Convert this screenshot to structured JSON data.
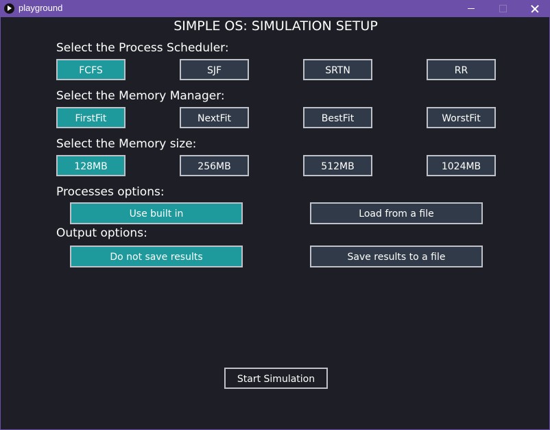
{
  "window": {
    "title": "playground"
  },
  "heading": "SIMPLE OS: SIMULATION SETUP",
  "scheduler": {
    "label": "Select the Process Scheduler:",
    "options": [
      "FCFS",
      "SJF",
      "SRTN",
      "RR"
    ],
    "selected": "FCFS"
  },
  "memory_manager": {
    "label": "Select the Memory Manager:",
    "options": [
      "FirstFit",
      "NextFit",
      "BestFit",
      "WorstFit"
    ],
    "selected": "FirstFit"
  },
  "memory_size": {
    "label": "Select the Memory size:",
    "options": [
      "128MB",
      "256MB",
      "512MB",
      "1024MB"
    ],
    "selected": "128MB"
  },
  "processes": {
    "label": "Processes options:",
    "options": [
      "Use built in",
      "Load from a file"
    ],
    "selected": "Use built in"
  },
  "output": {
    "label": "Output options:",
    "options": [
      "Do not save results",
      "Save results to a file"
    ],
    "selected": "Do not save results"
  },
  "start_label": "Start Simulation",
  "colors": {
    "background": "#1e1f26",
    "titlebar": "#6b4fa8",
    "selected": "#1e9a9c",
    "unselected": "#303a48",
    "border": "#bfc3c9"
  },
  "icons": [
    "app-play-icon",
    "minimize-icon",
    "maximize-icon",
    "close-icon"
  ]
}
